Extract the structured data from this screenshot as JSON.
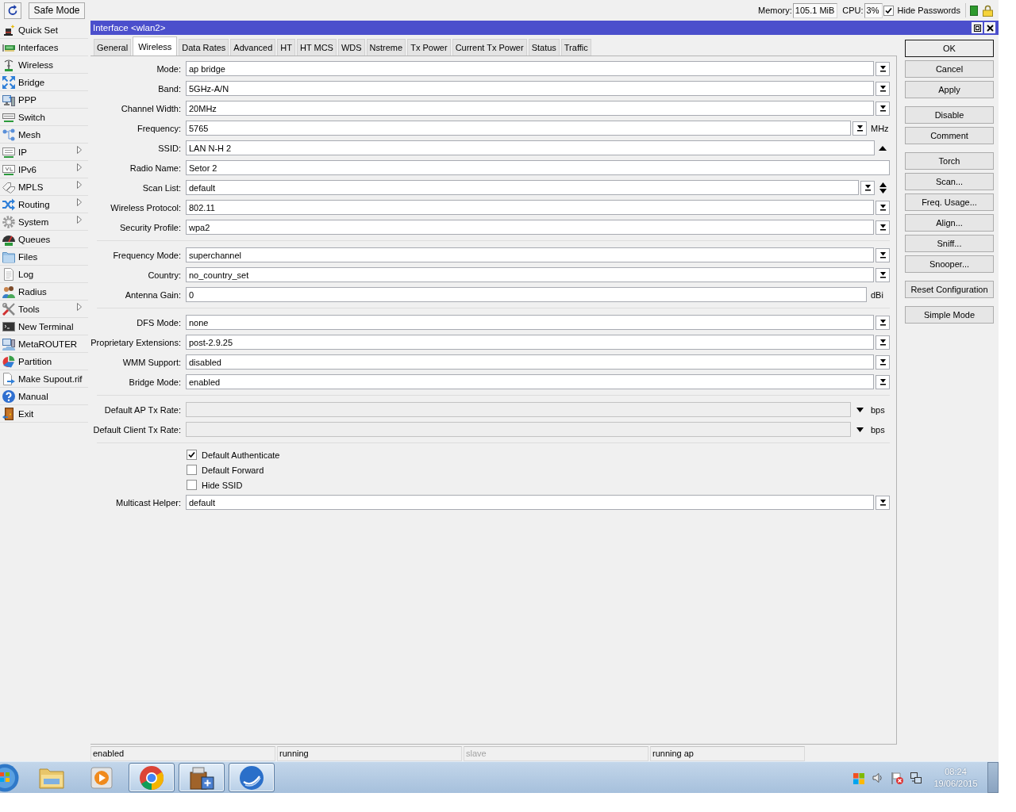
{
  "toolbar": {
    "safe_mode": "Safe Mode",
    "memory": {
      "label": "Memory:",
      "value": "105.1 MiB"
    },
    "cpu": {
      "label": "CPU:",
      "value": "3%"
    },
    "hide_passwords": {
      "label": "Hide Passwords",
      "checked": true
    }
  },
  "sidebar": {
    "items": [
      {
        "label": "Quick Set",
        "submenu": false
      },
      {
        "label": "Interfaces",
        "submenu": false
      },
      {
        "label": "Wireless",
        "submenu": false
      },
      {
        "label": "Bridge",
        "submenu": false
      },
      {
        "label": "PPP",
        "submenu": false
      },
      {
        "label": "Switch",
        "submenu": false
      },
      {
        "label": "Mesh",
        "submenu": false
      },
      {
        "label": "IP",
        "submenu": true
      },
      {
        "label": "IPv6",
        "submenu": true
      },
      {
        "label": "MPLS",
        "submenu": true
      },
      {
        "label": "Routing",
        "submenu": true
      },
      {
        "label": "System",
        "submenu": true
      },
      {
        "label": "Queues",
        "submenu": false
      },
      {
        "label": "Files",
        "submenu": false
      },
      {
        "label": "Log",
        "submenu": false
      },
      {
        "label": "Radius",
        "submenu": false
      },
      {
        "label": "Tools",
        "submenu": true
      },
      {
        "label": "New Terminal",
        "submenu": false
      },
      {
        "label": "MetaROUTER",
        "submenu": false
      },
      {
        "label": "Partition",
        "submenu": false
      },
      {
        "label": "Make Supout.rif",
        "submenu": false
      },
      {
        "label": "Manual",
        "submenu": false
      },
      {
        "label": "Exit",
        "submenu": false
      }
    ]
  },
  "window": {
    "title": "Interface <wlan2>",
    "tabs": [
      {
        "label": "General",
        "selected": false
      },
      {
        "label": "Wireless",
        "selected": true
      },
      {
        "label": "Data Rates",
        "selected": false
      },
      {
        "label": "Advanced",
        "selected": false
      },
      {
        "label": "HT",
        "selected": false
      },
      {
        "label": "HT MCS",
        "selected": false
      },
      {
        "label": "WDS",
        "selected": false
      },
      {
        "label": "Nstreme",
        "selected": false
      },
      {
        "label": "Tx Power",
        "selected": false
      },
      {
        "label": "Current Tx Power",
        "selected": false
      },
      {
        "label": "Status",
        "selected": false
      },
      {
        "label": "Traffic",
        "selected": false
      }
    ],
    "sections": [
      {
        "rows": [
          {
            "kind": "dropdown",
            "label": "Mode:",
            "value": "ap bridge",
            "disabled": false
          },
          {
            "kind": "dropdown",
            "label": "Band:",
            "value": "5GHz-A/N",
            "disabled": false
          },
          {
            "kind": "dropdown",
            "label": "Channel Width:",
            "value": "20MHz",
            "disabled": false
          },
          {
            "kind": "dropdown",
            "label": "Frequency:",
            "value": "5765",
            "unit": "MHz",
            "disabled": false
          },
          {
            "kind": "collapsible",
            "label": "SSID:",
            "value": "LAN N-H 2",
            "disabled": false
          },
          {
            "kind": "text",
            "label": "Radio Name:",
            "value": "Setor 2",
            "disabled": false
          },
          {
            "kind": "list",
            "label": "Scan List:",
            "value": "default",
            "disabled": false
          },
          {
            "kind": "dropdown",
            "label": "Wireless Protocol:",
            "value": "802.11",
            "disabled": false
          },
          {
            "kind": "dropdown",
            "label": "Security Profile:",
            "value": "wpa2",
            "disabled": false
          }
        ]
      },
      {
        "rows": [
          {
            "kind": "dropdown",
            "label": "Frequency Mode:",
            "value": "superchannel",
            "disabled": false
          },
          {
            "kind": "dropdown",
            "label": "Country:",
            "value": "no_country_set",
            "disabled": false
          },
          {
            "kind": "text",
            "label": "Antenna Gain:",
            "value": "0",
            "unit": "dBi",
            "disabled": false
          }
        ]
      },
      {
        "rows": [
          {
            "kind": "dropdown",
            "label": "DFS Mode:",
            "value": "none",
            "disabled": false
          },
          {
            "kind": "dropdown",
            "label": "Proprietary Extensions:",
            "value": "post-2.9.25",
            "disabled": false
          },
          {
            "kind": "dropdown",
            "label": "WMM Support:",
            "value": "disabled",
            "disabled": false
          },
          {
            "kind": "dropdown",
            "label": "Bridge Mode:",
            "value": "enabled",
            "disabled": false
          }
        ]
      },
      {
        "rows": [
          {
            "kind": "rate",
            "label": "Default AP Tx Rate:",
            "unit": "bps",
            "disabled": true
          },
          {
            "kind": "rate",
            "label": "Default Client Tx Rate:",
            "unit": "bps",
            "disabled": true
          }
        ]
      },
      {
        "rows": [
          {
            "kind": "checkbox",
            "label": "Default Authenticate",
            "checked": true,
            "disabled": false
          },
          {
            "kind": "checkbox",
            "label": "Default Forward",
            "checked": false,
            "disabled": false
          },
          {
            "kind": "checkbox",
            "label": "Hide SSID",
            "checked": false,
            "disabled": false
          },
          {
            "kind": "dropdown",
            "label": "Multicast Helper:",
            "value": "default",
            "disabled": false
          }
        ]
      }
    ],
    "buttons": [
      [
        {
          "label": "OK",
          "default": true
        },
        {
          "label": "Cancel",
          "default": false
        },
        {
          "label": "Apply",
          "default": false
        }
      ],
      [
        {
          "label": "Disable",
          "default": false
        },
        {
          "label": "Comment",
          "default": false
        }
      ],
      [
        {
          "label": "Torch",
          "default": false
        },
        {
          "label": "Scan...",
          "default": false
        },
        {
          "label": "Freq. Usage...",
          "default": false
        },
        {
          "label": "Align...",
          "default": false
        },
        {
          "label": "Sniff...",
          "default": false
        },
        {
          "label": "Snooper...",
          "default": false
        }
      ],
      [
        {
          "label": "Reset Configuration",
          "default": false
        }
      ],
      [
        {
          "label": "Simple Mode",
          "default": false
        }
      ]
    ],
    "status_bar": [
      {
        "text": "enabled",
        "dimmed": false
      },
      {
        "text": "running",
        "dimmed": false
      },
      {
        "text": "slave",
        "dimmed": true
      },
      {
        "text": "running ap",
        "dimmed": false
      }
    ]
  },
  "taskbar": {
    "apps": [
      {
        "running": false
      },
      {
        "running": false
      },
      {
        "running": true
      },
      {
        "running": true
      },
      {
        "running": true
      }
    ],
    "clock": {
      "time": "08:24",
      "date": "19/06/2015"
    }
  }
}
